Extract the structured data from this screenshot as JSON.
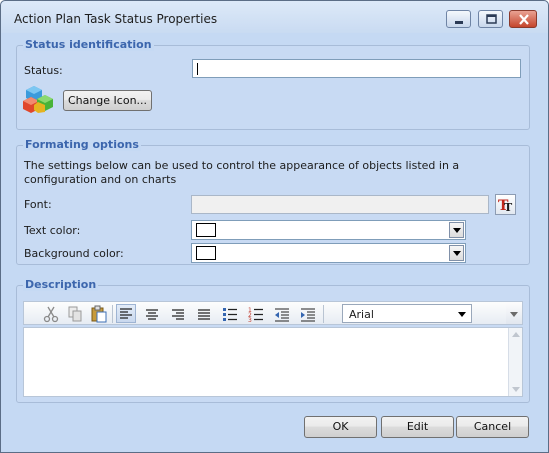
{
  "window": {
    "title": "Action Plan Task Status Properties"
  },
  "status_group": {
    "title": "Status identification",
    "status_label": "Status:",
    "status_value": "",
    "change_icon_label": "Change Icon..."
  },
  "format_group": {
    "title": "Formating options",
    "description": "The settings below can be used to control the appearance of objects listed in a configuration and on charts",
    "font_label": "Font:",
    "font_value": "",
    "text_color_label": "Text color:",
    "text_color_value": "#ffffff",
    "background_color_label": "Background color:",
    "background_color_value": "#ffffff"
  },
  "description_group": {
    "title": "Description",
    "font_select": "Arial",
    "toolbar_icons": [
      "cut-icon",
      "copy-icon",
      "paste-icon",
      "align-left-icon",
      "align-center-icon",
      "align-right-icon",
      "justify-icon",
      "bullet-list-icon",
      "numbered-list-icon",
      "outdent-icon",
      "indent-icon"
    ],
    "body_text": ""
  },
  "footer": {
    "ok_label": "OK",
    "edit_label": "Edit",
    "cancel_label": "Cancel"
  },
  "colors": {
    "window_bg": "#c5d9f3",
    "group_title": "#3c66ad",
    "close_button": "#c5452c"
  }
}
